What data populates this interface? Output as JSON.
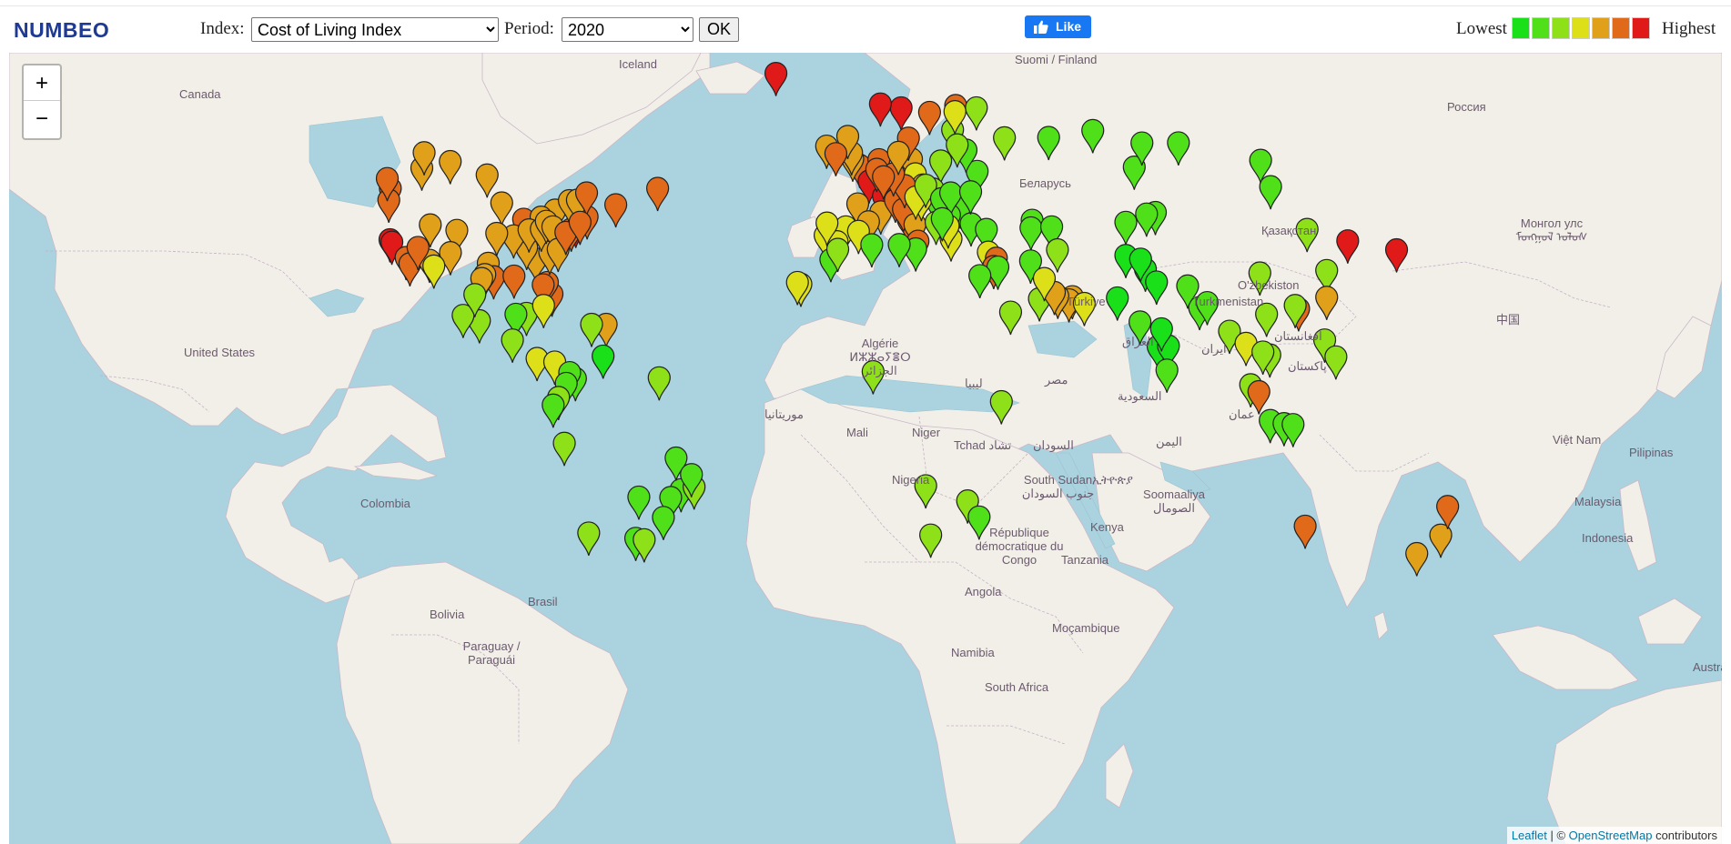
{
  "header": {
    "logo": "NUMBEO",
    "index_label": "Index:",
    "index_selected": "Cost of Living Index",
    "period_label": "Period:",
    "period_selected": "2020",
    "ok_label": "OK",
    "fb_like_label": "Like",
    "legend_lowest": "Lowest",
    "legend_highest": "Highest",
    "legend_colors": [
      "#19e019",
      "#50e019",
      "#8ee019",
      "#dde019",
      "#e0a019",
      "#e06a19",
      "#e01919"
    ]
  },
  "map": {
    "zoom_in": "+",
    "zoom_out": "−",
    "attribution_link1": "Leaflet",
    "attribution_sep": " | © ",
    "attribution_link2": "OpenStreetMap",
    "attribution_tail": " contributors",
    "ocean_color": "#aad3df",
    "land_color": "#f2efe9",
    "labels": [
      "Canada",
      "United States",
      "Iceland",
      "Suomi / Finland",
      "Россия",
      "Қазақстан",
      "O'zbekiston",
      "Turkmenistan",
      "افغانستان",
      "پاکستان",
      "ایران",
      "العراق",
      "Türkiye",
      "مصر",
      "السعودية",
      "عمان",
      "اليمن",
      "ليبيا",
      "Algérie ⵍⵣⵣⴰⵢⴻⵔ الجزائر",
      "موريتانيا",
      "Mali",
      "Niger",
      "Tchad تشاد",
      "السودان",
      "Nigeria",
      "South Sudan جنوب السودان",
      "ኢትዮጵያ",
      "Soomaaliya الصومال",
      "Kenya",
      "République démocratique du Congo",
      "Tanzania",
      "Angola",
      "Namibia",
      "Moçambique",
      "South Africa",
      "Colombia",
      "Brasil",
      "Bolivia",
      "Paraguay / Paraguái",
      "中国",
      "Монгол улс ᠮᠣᠩᠭᠣᠯ ᠤᠯᠤᠰ",
      "Việt Nam",
      "Malaysia",
      "Indonesia",
      "Pilipinas",
      "Australia",
      "Беларусь"
    ]
  },
  "markers": [
    {
      "lon": -8.7,
      "lat": 54.5,
      "color": "#e0a019"
    },
    {
      "lon": -0.1,
      "lat": 51.5,
      "color": "#e06a19"
    },
    {
      "lon": 2.35,
      "lat": 48.86,
      "color": "#e01919"
    },
    {
      "lon": 13.4,
      "lat": 52.5,
      "color": "#e0a019"
    },
    {
      "lon": 12.5,
      "lat": 41.9,
      "color": "#e06a19"
    },
    {
      "lon": -3.7,
      "lat": 40.4,
      "color": "#dde019"
    },
    {
      "lon": -9.1,
      "lat": 38.7,
      "color": "#dde019"
    },
    {
      "lon": 4.9,
      "lat": 52.4,
      "color": "#e06a19"
    },
    {
      "lon": 8.5,
      "lat": 47.4,
      "color": "#e01919"
    },
    {
      "lon": 6.1,
      "lat": 46.2,
      "color": "#e01919"
    },
    {
      "lon": 10.7,
      "lat": 59.9,
      "color": "#e01919"
    },
    {
      "lon": 18.1,
      "lat": 59.3,
      "color": "#e06a19"
    },
    {
      "lon": 12.6,
      "lat": 55.7,
      "color": "#e06a19"
    },
    {
      "lon": 24.9,
      "lat": 60.2,
      "color": "#e06a19"
    },
    {
      "lon": 21.0,
      "lat": 52.2,
      "color": "#8ee019"
    },
    {
      "lon": 14.4,
      "lat": 50.1,
      "color": "#dde019"
    },
    {
      "lon": 19.0,
      "lat": 47.5,
      "color": "#8ee019"
    },
    {
      "lon": 26.1,
      "lat": 44.4,
      "color": "#50e019"
    },
    {
      "lon": 23.3,
      "lat": 42.7,
      "color": "#50e019"
    },
    {
      "lon": 20.5,
      "lat": 44.8,
      "color": "#50e019"
    },
    {
      "lon": 23.7,
      "lat": 37.98,
      "color": "#dde019"
    },
    {
      "lon": 28.9,
      "lat": 41.0,
      "color": "#50e019"
    },
    {
      "lon": 32.9,
      "lat": 39.9,
      "color": "#50e019"
    },
    {
      "lon": 30.5,
      "lat": 50.5,
      "color": "#50e019"
    },
    {
      "lon": 27.6,
      "lat": 53.9,
      "color": "#50e019"
    },
    {
      "lon": 37.6,
      "lat": 55.75,
      "color": "#8ee019"
    },
    {
      "lon": 30.3,
      "lat": 59.9,
      "color": "#8ee019"
    },
    {
      "lon": 24.1,
      "lat": 56.9,
      "color": "#8ee019"
    },
    {
      "lon": 25.3,
      "lat": 54.7,
      "color": "#8ee019"
    },
    {
      "lon": 24.7,
      "lat": 59.4,
      "color": "#dde019"
    },
    {
      "lon": -21.9,
      "lat": 64.1,
      "color": "#e01919"
    },
    {
      "lon": 5.3,
      "lat": 60.4,
      "color": "#e01919"
    },
    {
      "lon": -1.9,
      "lat": 52.5,
      "color": "#e0a019"
    },
    {
      "lon": -2.2,
      "lat": 53.5,
      "color": "#e0a019"
    },
    {
      "lon": -3.2,
      "lat": 55.95,
      "color": "#e0a019"
    },
    {
      "lon": -6.3,
      "lat": 53.35,
      "color": "#e06a19"
    },
    {
      "lon": -0.6,
      "lat": 44.8,
      "color": "#e0a019"
    },
    {
      "lon": 5.4,
      "lat": 43.3,
      "color": "#e0a019"
    },
    {
      "lon": 2.2,
      "lat": 41.4,
      "color": "#e0a019"
    },
    {
      "lon": -0.4,
      "lat": 39.5,
      "color": "#dde019"
    },
    {
      "lon": -5.98,
      "lat": 37.4,
      "color": "#dde019"
    },
    {
      "lon": -8.6,
      "lat": 41.15,
      "color": "#dde019"
    },
    {
      "lon": 9.2,
      "lat": 45.5,
      "color": "#e06a19"
    },
    {
      "lon": 11.3,
      "lat": 43.8,
      "color": "#e06a19"
    },
    {
      "lon": 14.3,
      "lat": 40.85,
      "color": "#e0a019"
    },
    {
      "lon": 15.1,
      "lat": 37.5,
      "color": "#e06a19"
    },
    {
      "lon": 16.4,
      "lat": 48.2,
      "color": "#e0a019"
    },
    {
      "lon": 11.6,
      "lat": 48.1,
      "color": "#e06a19"
    },
    {
      "lon": 8.7,
      "lat": 50.1,
      "color": "#e06a19"
    },
    {
      "lon": 10.0,
      "lat": 53.55,
      "color": "#e0a019"
    },
    {
      "lon": 4.35,
      "lat": 50.85,
      "color": "#e06a19"
    },
    {
      "lon": 6.1,
      "lat": 49.6,
      "color": "#e06a19"
    },
    {
      "lon": 15.98,
      "lat": 45.8,
      "color": "#dde019"
    },
    {
      "lon": 14.5,
      "lat": 46.05,
      "color": "#dde019"
    },
    {
      "lon": 17.1,
      "lat": 48.15,
      "color": "#8ee019"
    },
    {
      "lon": 21.2,
      "lat": 45.75,
      "color": "#50e019"
    },
    {
      "lon": 23.6,
      "lat": 46.8,
      "color": "#50e019"
    },
    {
      "lon": 28.8,
      "lat": 47.0,
      "color": "#50e019"
    },
    {
      "lon": 22.95,
      "lat": 40.6,
      "color": "#dde019"
    },
    {
      "lon": 19.8,
      "lat": 41.3,
      "color": "#8ee019"
    },
    {
      "lon": 21.4,
      "lat": 42.0,
      "color": "#50e019"
    },
    {
      "lon": 14.5,
      "lat": 35.9,
      "color": "#50e019"
    },
    {
      "lon": 33.4,
      "lat": 35.2,
      "color": "#dde019"
    },
    {
      "lon": 35.5,
      "lat": 33.9,
      "color": "#e06a19"
    },
    {
      "lon": 34.8,
      "lat": 32.1,
      "color": "#e06a19"
    },
    {
      "lon": 35.9,
      "lat": 31.95,
      "color": "#50e019"
    },
    {
      "lon": 31.2,
      "lat": 30.05,
      "color": "#50e019"
    },
    {
      "lon": 44.8,
      "lat": 41.7,
      "color": "#50e019"
    },
    {
      "lon": 44.5,
      "lat": 40.2,
      "color": "#50e019"
    },
    {
      "lon": 49.9,
      "lat": 40.4,
      "color": "#50e019"
    },
    {
      "lon": 51.4,
      "lat": 35.7,
      "color": "#8ee019"
    },
    {
      "lon": 44.4,
      "lat": 33.3,
      "color": "#50e019"
    },
    {
      "lon": 46.7,
      "lat": 24.7,
      "color": "#8ee019"
    },
    {
      "lon": 55.3,
      "lat": 25.2,
      "color": "#e0a019"
    },
    {
      "lon": 54.4,
      "lat": 24.45,
      "color": "#e0a019"
    },
    {
      "lon": 51.5,
      "lat": 25.3,
      "color": "#e0a019"
    },
    {
      "lon": 50.6,
      "lat": 26.2,
      "color": "#e0a019"
    },
    {
      "lon": 47.98,
      "lat": 29.4,
      "color": "#dde019"
    },
    {
      "lon": 58.4,
      "lat": 23.6,
      "color": "#dde019"
    },
    {
      "lon": 39.2,
      "lat": 21.5,
      "color": "#8ee019"
    },
    {
      "lon": 69.2,
      "lat": 41.3,
      "color": "#50e019"
    },
    {
      "lon": 71.4,
      "lat": 51.2,
      "color": "#50e019"
    },
    {
      "lon": 76.9,
      "lat": 43.2,
      "color": "#50e019"
    },
    {
      "lon": 74.6,
      "lat": 42.9,
      "color": "#50e019"
    },
    {
      "lon": 69.2,
      "lat": 34.5,
      "color": "#19e019"
    },
    {
      "lon": 67.0,
      "lat": 24.9,
      "color": "#19e019"
    },
    {
      "lon": 74.3,
      "lat": 31.5,
      "color": "#19e019"
    },
    {
      "lon": 73.05,
      "lat": 33.7,
      "color": "#19e019"
    },
    {
      "lon": 77.2,
      "lat": 28.6,
      "color": "#19e019"
    },
    {
      "lon": 72.9,
      "lat": 19.1,
      "color": "#50e019"
    },
    {
      "lon": 77.6,
      "lat": 12.97,
      "color": "#19e019"
    },
    {
      "lon": 80.3,
      "lat": 13.1,
      "color": "#19e019"
    },
    {
      "lon": 78.5,
      "lat": 17.4,
      "color": "#19e019"
    },
    {
      "lon": 88.4,
      "lat": 22.6,
      "color": "#50e019"
    },
    {
      "lon": 85.3,
      "lat": 27.7,
      "color": "#50e019"
    },
    {
      "lon": 90.4,
      "lat": 23.8,
      "color": "#50e019"
    },
    {
      "lon": 79.9,
      "lat": 6.9,
      "color": "#50e019"
    },
    {
      "lon": 96.2,
      "lat": 16.8,
      "color": "#8ee019"
    },
    {
      "lon": 100.5,
      "lat": 13.75,
      "color": "#dde019"
    },
    {
      "lon": 105.85,
      "lat": 21.0,
      "color": "#8ee019"
    },
    {
      "lon": 106.7,
      "lat": 10.8,
      "color": "#8ee019"
    },
    {
      "lon": 104.9,
      "lat": 11.55,
      "color": "#8ee019"
    },
    {
      "lon": 101.7,
      "lat": 3.1,
      "color": "#8ee019"
    },
    {
      "lon": 103.85,
      "lat": 1.3,
      "color": "#e06a19"
    },
    {
      "lon": 106.8,
      "lat": -6.2,
      "color": "#50e019"
    },
    {
      "lon": 110.4,
      "lat": -7.0,
      "color": "#50e019"
    },
    {
      "lon": 112.75,
      "lat": -7.25,
      "color": "#50e019"
    },
    {
      "lon": 120.98,
      "lat": 14.6,
      "color": "#8ee019"
    },
    {
      "lon": 123.9,
      "lat": 10.3,
      "color": "#8ee019"
    },
    {
      "lon": 116.4,
      "lat": 39.9,
      "color": "#8ee019"
    },
    {
      "lon": 121.5,
      "lat": 31.2,
      "color": "#8ee019"
    },
    {
      "lon": 114.2,
      "lat": 22.3,
      "color": "#e06a19"
    },
    {
      "lon": 113.3,
      "lat": 23.1,
      "color": "#8ee019"
    },
    {
      "lon": 104.1,
      "lat": 30.65,
      "color": "#8ee019"
    },
    {
      "lon": 121.5,
      "lat": 25.05,
      "color": "#e0a019"
    },
    {
      "lon": 126.98,
      "lat": 37.57,
      "color": "#e01919"
    },
    {
      "lon": 139.7,
      "lat": 35.7,
      "color": "#e01919"
    },
    {
      "lon": 106.9,
      "lat": 47.9,
      "color": "#50e019"
    },
    {
      "lon": 82.9,
      "lat": 55.0,
      "color": "#50e019"
    },
    {
      "lon": 60.6,
      "lat": 56.8,
      "color": "#50e019"
    },
    {
      "lon": 49.1,
      "lat": 55.8,
      "color": "#50e019"
    },
    {
      "lon": 104.3,
      "lat": 52.3,
      "color": "#50e019"
    },
    {
      "lon": 73.4,
      "lat": 54.98,
      "color": "#50e019"
    },
    {
      "lon": 151.2,
      "lat": -33.9,
      "color": "#e0a019"
    },
    {
      "lon": 144.96,
      "lat": -37.8,
      "color": "#e0a019"
    },
    {
      "lon": 153.0,
      "lat": -27.5,
      "color": "#e06a19"
    },
    {
      "lon": 115.9,
      "lat": -31.95,
      "color": "#e06a19"
    },
    {
      "lon": 36.8,
      "lat": -1.3,
      "color": "#8ee019"
    },
    {
      "lon": 3.4,
      "lat": 6.5,
      "color": "#8ee019"
    },
    {
      "lon": 28.0,
      "lat": -26.2,
      "color": "#8ee019"
    },
    {
      "lon": 18.4,
      "lat": -33.9,
      "color": "#8ee019"
    },
    {
      "lon": 31.0,
      "lat": -29.9,
      "color": "#50e019"
    },
    {
      "lon": 17.1,
      "lat": -22.6,
      "color": "#8ee019"
    },
    {
      "lon": -7.6,
      "lat": 33.6,
      "color": "#50e019"
    },
    {
      "lon": -5.8,
      "lat": 35.8,
      "color": "#8ee019"
    },
    {
      "lon": 10.2,
      "lat": 36.8,
      "color": "#50e019"
    },
    {
      "lon": 3.05,
      "lat": 36.75,
      "color": "#50e019"
    },
    {
      "lon": -15.4,
      "lat": 28.1,
      "color": "#dde019"
    },
    {
      "lon": -16.3,
      "lat": 28.5,
      "color": "#dde019"
    },
    {
      "lon": -74.0,
      "lat": 40.7,
      "color": "#e01919"
    },
    {
      "lon": -71.06,
      "lat": 42.36,
      "color": "#e06a19"
    },
    {
      "lon": -77.0,
      "lat": 38.9,
      "color": "#e06a19"
    },
    {
      "lon": -75.2,
      "lat": 39.95,
      "color": "#e06a19"
    },
    {
      "lon": -87.6,
      "lat": 41.9,
      "color": "#e06a19"
    },
    {
      "lon": -122.4,
      "lat": 37.8,
      "color": "#e01919"
    },
    {
      "lon": -121.9,
      "lat": 37.3,
      "color": "#e01919"
    },
    {
      "lon": -118.2,
      "lat": 34.05,
      "color": "#e06a19"
    },
    {
      "lon": -117.2,
      "lat": 32.7,
      "color": "#e06a19"
    },
    {
      "lon": -122.3,
      "lat": 47.6,
      "color": "#e06a19"
    },
    {
      "lon": -122.7,
      "lat": 45.5,
      "color": "#e06a19"
    },
    {
      "lon": -123.1,
      "lat": 49.3,
      "color": "#e06a19"
    },
    {
      "lon": -114.1,
      "lat": 51.05,
      "color": "#e0a019"
    },
    {
      "lon": -113.5,
      "lat": 53.5,
      "color": "#e0a019"
    },
    {
      "lon": -106.7,
      "lat": 52.1,
      "color": "#e0a019"
    },
    {
      "lon": -97.1,
      "lat": 49.9,
      "color": "#e0a019"
    },
    {
      "lon": -79.4,
      "lat": 43.65,
      "color": "#e0a019"
    },
    {
      "lon": -75.7,
      "lat": 45.4,
      "color": "#e0a019"
    },
    {
      "lon": -73.6,
      "lat": 45.5,
      "color": "#e0a019"
    },
    {
      "lon": -71.2,
      "lat": 46.8,
      "color": "#e06a19"
    },
    {
      "lon": -63.6,
      "lat": 44.65,
      "color": "#e06a19"
    },
    {
      "lon": -52.7,
      "lat": 47.6,
      "color": "#e06a19"
    },
    {
      "lon": -104.99,
      "lat": 39.7,
      "color": "#e0a019"
    },
    {
      "lon": -112.1,
      "lat": 33.45,
      "color": "#e0a019"
    },
    {
      "lon": -115.1,
      "lat": 36.2,
      "color": "#e06a19"
    },
    {
      "lon": -111.9,
      "lat": 40.8,
      "color": "#e0a019"
    },
    {
      "lon": -96.8,
      "lat": 32.8,
      "color": "#e0a019"
    },
    {
      "lon": -95.4,
      "lat": 29.8,
      "color": "#e06a19"
    },
    {
      "lon": -97.7,
      "lat": 30.3,
      "color": "#e0a019"
    },
    {
      "lon": -98.5,
      "lat": 29.4,
      "color": "#e0a019"
    },
    {
      "lon": -84.4,
      "lat": 33.75,
      "color": "#e0a019"
    },
    {
      "lon": -80.2,
      "lat": 25.8,
      "color": "#e06a19"
    },
    {
      "lon": -81.4,
      "lat": 28.5,
      "color": "#e06a19"
    },
    {
      "lon": -82.5,
      "lat": 27.95,
      "color": "#e06a19"
    },
    {
      "lon": -90.1,
      "lat": 29.95,
      "color": "#e06a19"
    },
    {
      "lon": -86.8,
      "lat": 36.2,
      "color": "#e0a019"
    },
    {
      "lon": -80.8,
      "lat": 35.2,
      "color": "#e0a019"
    },
    {
      "lon": -83.05,
      "lat": 42.3,
      "color": "#e0a019"
    },
    {
      "lon": -93.3,
      "lat": 44.98,
      "color": "#e0a019"
    },
    {
      "lon": -90.2,
      "lat": 38.6,
      "color": "#e0a019"
    },
    {
      "lon": -94.6,
      "lat": 39.1,
      "color": "#e0a019"
    },
    {
      "lon": -86.2,
      "lat": 39.8,
      "color": "#e0a019"
    },
    {
      "lon": -82.99,
      "lat": 39.96,
      "color": "#e0a019"
    },
    {
      "lon": -81.7,
      "lat": 41.5,
      "color": "#e0a019"
    },
    {
      "lon": -79.99,
      "lat": 40.4,
      "color": "#e0a019"
    },
    {
      "lon": -78.6,
      "lat": 35.8,
      "color": "#e0a019"
    },
    {
      "lon": -76.6,
      "lat": 39.3,
      "color": "#e06a19"
    },
    {
      "lon": -72.9,
      "lat": 41.3,
      "color": "#e06a19"
    },
    {
      "lon": -106.65,
      "lat": 35.1,
      "color": "#e0a019"
    },
    {
      "lon": -110.97,
      "lat": 32.2,
      "color": "#dde019"
    },
    {
      "lon": -99.1,
      "lat": 19.4,
      "color": "#8ee019"
    },
    {
      "lon": -103.35,
      "lat": 20.7,
      "color": "#8ee019"
    },
    {
      "lon": -100.3,
      "lat": 25.7,
      "color": "#8ee019"
    },
    {
      "lon": -86.85,
      "lat": 21.2,
      "color": "#8ee019"
    },
    {
      "lon": -89.6,
      "lat": 20.97,
      "color": "#50e019"
    },
    {
      "lon": -90.5,
      "lat": 14.6,
      "color": "#8ee019"
    },
    {
      "lon": -84.1,
      "lat": 9.9,
      "color": "#dde019"
    },
    {
      "lon": -79.5,
      "lat": 8.98,
      "color": "#dde019"
    },
    {
      "lon": -82.4,
      "lat": 23.1,
      "color": "#dde019"
    },
    {
      "lon": -66.1,
      "lat": 18.5,
      "color": "#e0a019"
    },
    {
      "lon": -69.9,
      "lat": 18.5,
      "color": "#8ee019"
    },
    {
      "lon": -74.1,
      "lat": 4.7,
      "color": "#50e019"
    },
    {
      "lon": -75.6,
      "lat": 6.25,
      "color": "#50e019"
    },
    {
      "lon": -76.5,
      "lat": 3.45,
      "color": "#50e019"
    },
    {
      "lon": -78.5,
      "lat": -0.2,
      "color": "#8ee019"
    },
    {
      "lon": -79.9,
      "lat": -2.2,
      "color": "#50e019"
    },
    {
      "lon": -77.0,
      "lat": -12.05,
      "color": "#8ee019"
    },
    {
      "lon": -66.9,
      "lat": 10.5,
      "color": "#19e019"
    },
    {
      "lon": -58.4,
      "lat": -34.6,
      "color": "#50e019"
    },
    {
      "lon": -56.2,
      "lat": -34.9,
      "color": "#8ee019"
    },
    {
      "lon": -70.65,
      "lat": -33.45,
      "color": "#8ee019"
    },
    {
      "lon": -57.6,
      "lat": -25.3,
      "color": "#50e019"
    },
    {
      "lon": -46.6,
      "lat": -23.55,
      "color": "#50e019"
    },
    {
      "lon": -43.2,
      "lat": -22.9,
      "color": "#8ee019"
    },
    {
      "lon": -49.3,
      "lat": -25.4,
      "color": "#50e019"
    },
    {
      "lon": -51.2,
      "lat": -30.0,
      "color": "#50e019"
    },
    {
      "lon": -47.9,
      "lat": -15.8,
      "color": "#50e019"
    },
    {
      "lon": -43.9,
      "lat": -19.9,
      "color": "#50e019"
    },
    {
      "lon": -52.3,
      "lat": 4.9,
      "color": "#8ee019"
    }
  ]
}
